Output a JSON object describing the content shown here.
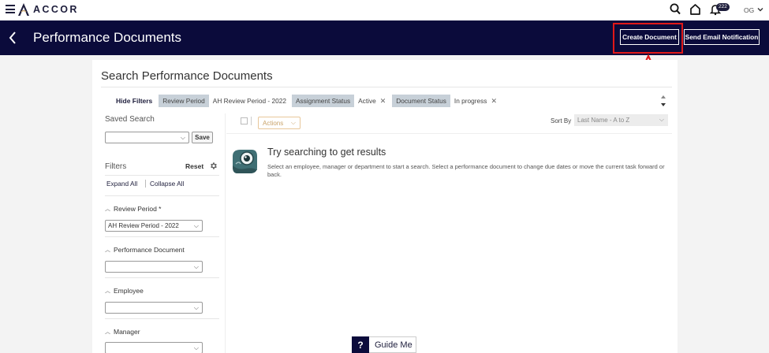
{
  "brand": {
    "logo_text": "ACCOR"
  },
  "topbar": {
    "notification_count": "222",
    "user_initials": "OG"
  },
  "header": {
    "title": "Performance Documents",
    "create_document_label": "Create Document",
    "send_email_label": "Send Email Notification"
  },
  "panel": {
    "title": "Search Performance Documents",
    "hide_filters_label": "Hide Filters",
    "chips": [
      {
        "label": "Review Period",
        "value": "AH Review Period - 2022"
      },
      {
        "label": "Assignment Status",
        "value": "Active",
        "x": "✕"
      },
      {
        "label": "Document Status",
        "value": "In progress",
        "x": "✕"
      }
    ]
  },
  "sidebar": {
    "saved_search_label": "Saved Search",
    "saved_search_value": "",
    "save_label": "Save",
    "filters_label": "Filters",
    "reset_label": "Reset",
    "expand_all_label": "Expand All",
    "collapse_all_label": "Collapse All",
    "sections": [
      {
        "label": "Review Period *",
        "value": "AH Review Period - 2022"
      },
      {
        "label": "Performance Document",
        "value": ""
      },
      {
        "label": "Employee",
        "value": ""
      },
      {
        "label": "Manager",
        "value": ""
      }
    ]
  },
  "results": {
    "actions_label": "Actions",
    "sort_by_label": "Sort By",
    "sort_by_value": "Last Name - A to Z",
    "empty_title": "Try searching to get results",
    "empty_description": "Select an employee, manager or department to start a search. Select a performance document to change due dates or move the current task forward or back."
  },
  "guide": {
    "q": "?",
    "label": "Guide Me"
  },
  "icons": {
    "menu": "hamburger-icon",
    "search": "search-icon",
    "home": "home-icon",
    "notifications": "bell-icon",
    "back": "chevron-left-icon",
    "settings": "gear-icon"
  },
  "colors": {
    "navy": "#0b0b3b",
    "highlight": "#e01818"
  }
}
